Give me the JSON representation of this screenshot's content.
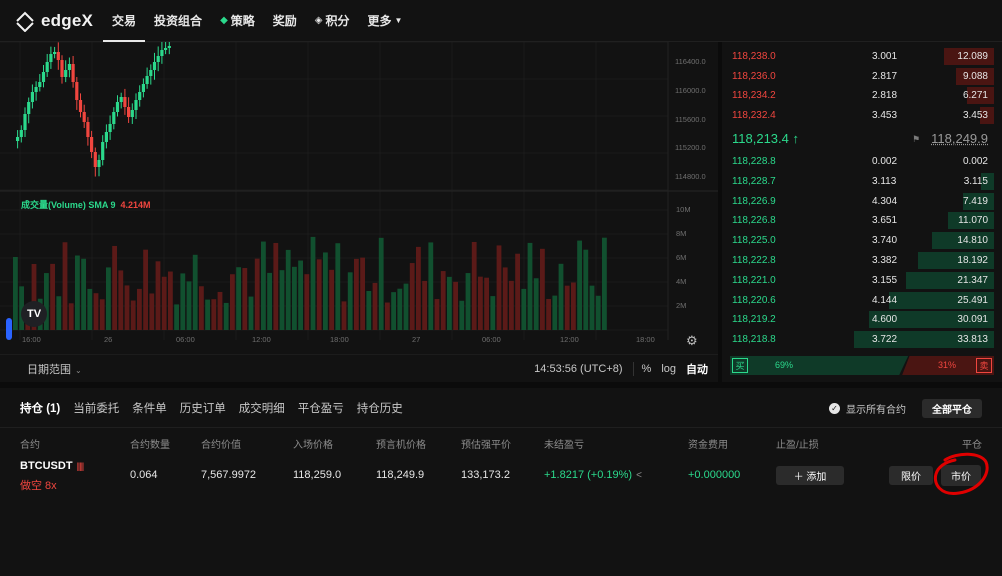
{
  "brand": {
    "name": "edgeX"
  },
  "nav": {
    "items": [
      {
        "label": "交易",
        "icon": "",
        "active": true
      },
      {
        "label": "投资组合",
        "icon": "",
        "active": false
      },
      {
        "label": "策略",
        "icon": "drop-icon",
        "active": false
      },
      {
        "label": "奖励",
        "icon": "",
        "active": false
      },
      {
        "label": "积分",
        "icon": "diamond-icon",
        "active": false
      },
      {
        "label": "更多",
        "icon": "chevron-down-icon",
        "active": false
      }
    ]
  },
  "chart": {
    "volume_label": "成交量(Volume) SMA 9",
    "volume_value": "4.214M",
    "tv_logo": "TV",
    "range_label": "日期范围",
    "clock": "14:53:56 (UTC+8)",
    "percent_btn": "%",
    "log_btn": "log",
    "auto_btn": "自动"
  },
  "chart_data": {
    "type": "candlestick",
    "price_axis_ticks": [
      "116400.0",
      "116000.0",
      "115600.0",
      "115200.0",
      "114800.0"
    ],
    "volume_axis_ticks": [
      "10M",
      "8M",
      "6M",
      "4M",
      "2M"
    ],
    "time_axis_ticks": [
      "16:00",
      "26",
      "06:00",
      "12:00",
      "18:00",
      "27",
      "06:00",
      "12:00",
      "18:00"
    ],
    "grid": true,
    "colors": {
      "up": "#2bd98c",
      "down": "#f0463f"
    }
  },
  "orderbook": {
    "asks": [
      {
        "price": "118,238.0",
        "size": "3.001",
        "total": "12.089",
        "depth": 0.36
      },
      {
        "price": "118,236.0",
        "size": "2.817",
        "total": "9.088",
        "depth": 0.27
      },
      {
        "price": "118,234.2",
        "size": "2.818",
        "total": "6.271",
        "depth": 0.19
      },
      {
        "price": "118,232.4",
        "size": "3.453",
        "total": "3.453",
        "depth": 0.1
      }
    ],
    "mid_price": "118,213.4",
    "mid_arrow": "↑",
    "mark_price": "118,249.9",
    "bids": [
      {
        "price": "118,228.8",
        "size": "0.002",
        "total": "0.002",
        "depth": 0.0
      },
      {
        "price": "118,228.7",
        "size": "3.113",
        "total": "3.115",
        "depth": 0.09
      },
      {
        "price": "118,226.9",
        "size": "4.304",
        "total": "7.419",
        "depth": 0.22
      },
      {
        "price": "118,226.8",
        "size": "3.651",
        "total": "11.070",
        "depth": 0.33
      },
      {
        "price": "118,225.0",
        "size": "3.740",
        "total": "14.810",
        "depth": 0.44
      },
      {
        "price": "118,222.8",
        "size": "3.382",
        "total": "18.192",
        "depth": 0.54
      },
      {
        "price": "118,221.0",
        "size": "3.155",
        "total": "21.347",
        "depth": 0.63
      },
      {
        "price": "118,220.6",
        "size": "4.144",
        "total": "25.491",
        "depth": 0.75
      },
      {
        "price": "118,219.2",
        "size": "4.600",
        "total": "30.091",
        "depth": 0.89
      },
      {
        "price": "118,218.8",
        "size": "3.722",
        "total": "33.813",
        "depth": 1.0
      }
    ],
    "buy_tag": "买",
    "sell_tag": "卖",
    "buy_pct": "69%",
    "sell_pct": "31%",
    "buy_ratio": 0.69
  },
  "positions": {
    "tabs": [
      "持仓 (1)",
      "当前委托",
      "条件单",
      "历史订单",
      "成交明细",
      "平仓盈亏",
      "持仓历史"
    ],
    "show_all_label": "显示所有合约",
    "close_all_label": "全部平仓",
    "headers": {
      "contract": "合约",
      "qty": "合约数量",
      "value": "合约价值",
      "entry": "入场价格",
      "mark": "预言机价格",
      "liq": "预估强平价",
      "pnl": "未结盈亏",
      "funding": "资金费用",
      "tpsl": "止盈/止损",
      "close": "平仓"
    },
    "row": {
      "symbol": "BTCUSDT",
      "side": "做空 8x",
      "qty": "0.064",
      "value": "7,567.9972",
      "entry": "118,259.0",
      "mark": "118,249.9",
      "liq": "133,173.2",
      "pnl": "+1.8217 (+0.19%)",
      "funding": "+0.000000",
      "add_label": "＋ 添加",
      "limit_label": "限价",
      "market_label": "市价"
    }
  }
}
